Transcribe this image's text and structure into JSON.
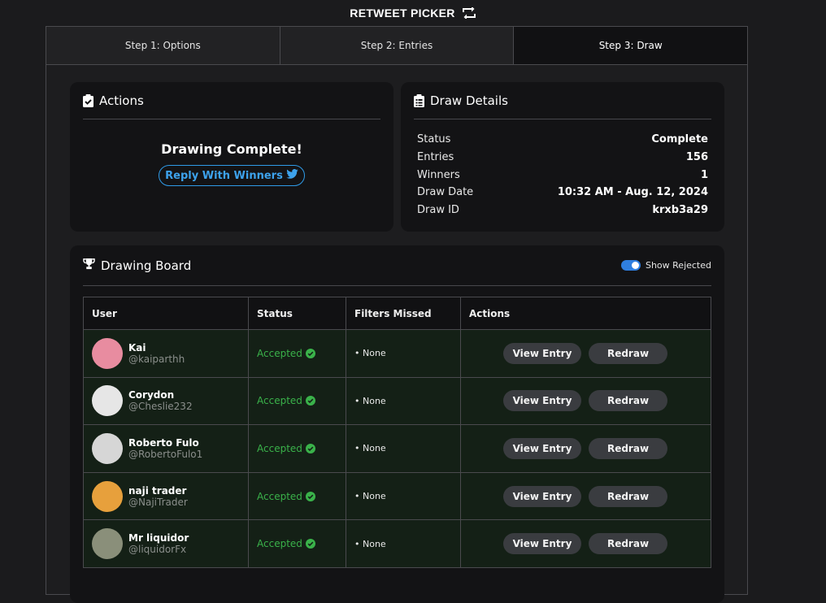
{
  "app": {
    "title": "RETWEET PICKER",
    "title_icon": "retweet-icon"
  },
  "steps": [
    {
      "label": "Step 1: Options"
    },
    {
      "label": "Step 2: Entries"
    },
    {
      "label": "Step 3: Draw"
    }
  ],
  "actions_panel": {
    "title": "Actions",
    "icon": "clipboard-check-icon",
    "message": "Drawing Complete!",
    "reply_label": "Reply With Winners",
    "reply_icon": "twitter-icon"
  },
  "details_panel": {
    "title": "Draw Details",
    "icon": "clipboard-list-icon",
    "rows": [
      {
        "key": "Status",
        "value": "Complete"
      },
      {
        "key": "Entries",
        "value": "156"
      },
      {
        "key": "Winners",
        "value": "1"
      },
      {
        "key": "Draw Date",
        "value": "10:32 AM - Aug. 12, 2024"
      },
      {
        "key": "Draw ID",
        "value": "krxb3a29"
      }
    ]
  },
  "board": {
    "title": "Drawing Board",
    "icon": "trophy-icon",
    "toggle_label": "Show Rejected",
    "toggle_on": true,
    "columns": [
      "User",
      "Status",
      "Filters Missed",
      "Actions"
    ],
    "view_label": "View Entry",
    "redraw_label": "Redraw",
    "rows": [
      {
        "name": "Kai",
        "handle": "@kaiparthh",
        "status": "Accepted",
        "filters": "• None",
        "avatar_color": "#e88ca0"
      },
      {
        "name": "Corydon",
        "handle": "@Cheslie232",
        "status": "Accepted",
        "filters": "• None",
        "avatar_color": "#e6e6e6"
      },
      {
        "name": "Roberto Fulo",
        "handle": "@RobertoFulo1",
        "status": "Accepted",
        "filters": "• None",
        "avatar_color": "#d6d6d6"
      },
      {
        "name": "naji trader",
        "handle": "@NajiTrader",
        "status": "Accepted",
        "filters": "• None",
        "avatar_color": "#e7a03c"
      },
      {
        "name": "Mr liquidor",
        "handle": "@liquidorFx",
        "status": "Accepted",
        "filters": "• None",
        "avatar_color": "#8a8f7a"
      }
    ]
  },
  "colors": {
    "accent_blue": "#2f9be8",
    "accepted_green": "#3ab24a",
    "row_bg": "#142016"
  }
}
